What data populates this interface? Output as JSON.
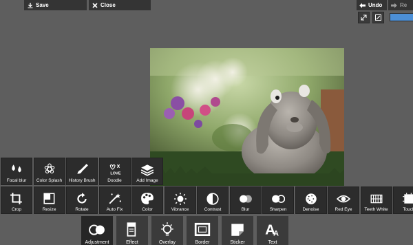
{
  "topbar": {
    "save_label": "Save",
    "close_label": "Close",
    "undo_label": "Undo",
    "redo_label": "Re"
  },
  "progress": {
    "value": 1.0,
    "color": "#4c8fd6"
  },
  "photo": {
    "subject": "gray lop-eared rabbit sitting on grass with flowers"
  },
  "tools_row1": [
    {
      "label": "Focal blur",
      "icon": "focal-blur-icon"
    },
    {
      "label": "Color Splash",
      "icon": "color-splash-icon"
    },
    {
      "label": "History Brush",
      "icon": "history-brush-icon"
    },
    {
      "label": "Doodle",
      "icon": "doodle-icon"
    },
    {
      "label": "Add Image",
      "icon": "add-image-icon"
    }
  ],
  "tools_row2": [
    {
      "label": "Crop",
      "icon": "crop-icon"
    },
    {
      "label": "Resize",
      "icon": "resize-icon"
    },
    {
      "label": "Rotate",
      "icon": "rotate-icon"
    },
    {
      "label": "Auto Fix",
      "icon": "auto-fix-icon"
    },
    {
      "label": "Color",
      "icon": "palette-icon"
    },
    {
      "label": "Vibrance",
      "icon": "sun-icon"
    },
    {
      "label": "Contrast",
      "icon": "contrast-icon"
    },
    {
      "label": "Blur",
      "icon": "blur-icon"
    },
    {
      "label": "Sharpen",
      "icon": "sharpen-icon"
    },
    {
      "label": "Denoise",
      "icon": "denoise-icon"
    },
    {
      "label": "Red Eye",
      "icon": "eye-icon"
    },
    {
      "label": "Teeth White",
      "icon": "teeth-icon"
    },
    {
      "label": "Touch",
      "icon": "touch-icon"
    }
  ],
  "categories": [
    {
      "label": "Adjustment",
      "icon": "adjustment-icon",
      "active": true
    },
    {
      "label": "Effect",
      "icon": "effect-icon"
    },
    {
      "label": "Overlay",
      "icon": "overlay-icon"
    },
    {
      "label": "Border",
      "icon": "border-icon"
    },
    {
      "label": "Sticker",
      "icon": "sticker-icon"
    },
    {
      "label": "Text",
      "icon": "text-icon"
    }
  ]
}
